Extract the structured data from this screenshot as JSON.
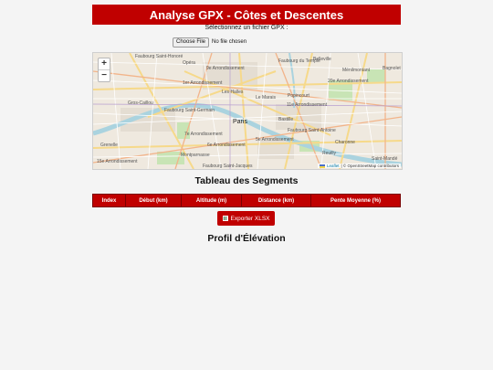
{
  "header": {
    "title": "Analyse GPX - Côtes et Descentes"
  },
  "file_picker": {
    "prompt": "Sélectionnez un fichier GPX :",
    "button_label": "Choose File",
    "status": "No file chosen"
  },
  "map": {
    "zoom_in": "+",
    "zoom_out": "−",
    "labels": [
      "Faubourg Saint-Honoré",
      "Opéra",
      "9e Arrondissement",
      "Faubourg du Temple",
      "Belleville",
      "1er Arrondissement",
      "Ménilmontant",
      "Les Halles",
      "Gros-Caillou",
      "Le Marais",
      "Popincourt",
      "20e Arrondissement",
      "11e Arrondissement",
      "Faubourg Saint-Germain",
      "Paris",
      "Bastille",
      "7e Arrondissement",
      "Bagnolet",
      "Faubourg Saint-Antoine",
      "Charonne",
      "Grenelle",
      "6e Arrondissement",
      "5e Arrondissement",
      "Reuilly",
      "Montparnasse",
      "Saint-Mandé",
      "15e Arrondissement",
      "Faubourg Saint-Jacques"
    ],
    "attribution_leaflet": "Leaflet",
    "attribution_text": "| © OpenStreetMap contributors"
  },
  "segments": {
    "title": "Tableau des Segments",
    "columns": [
      "Index",
      "Début (km)",
      "Altitude (m)",
      "Distance (km)",
      "Pente Moyenne (%)"
    ]
  },
  "export": {
    "label": "Exporter XLSX",
    "icon": "spreadsheet-icon"
  },
  "profile": {
    "title": "Profil d'Élévation"
  },
  "colors": {
    "accent": "#c00000",
    "map_bg": "#efe9df",
    "river": "#aad3df",
    "park": "#c8e4b5"
  }
}
